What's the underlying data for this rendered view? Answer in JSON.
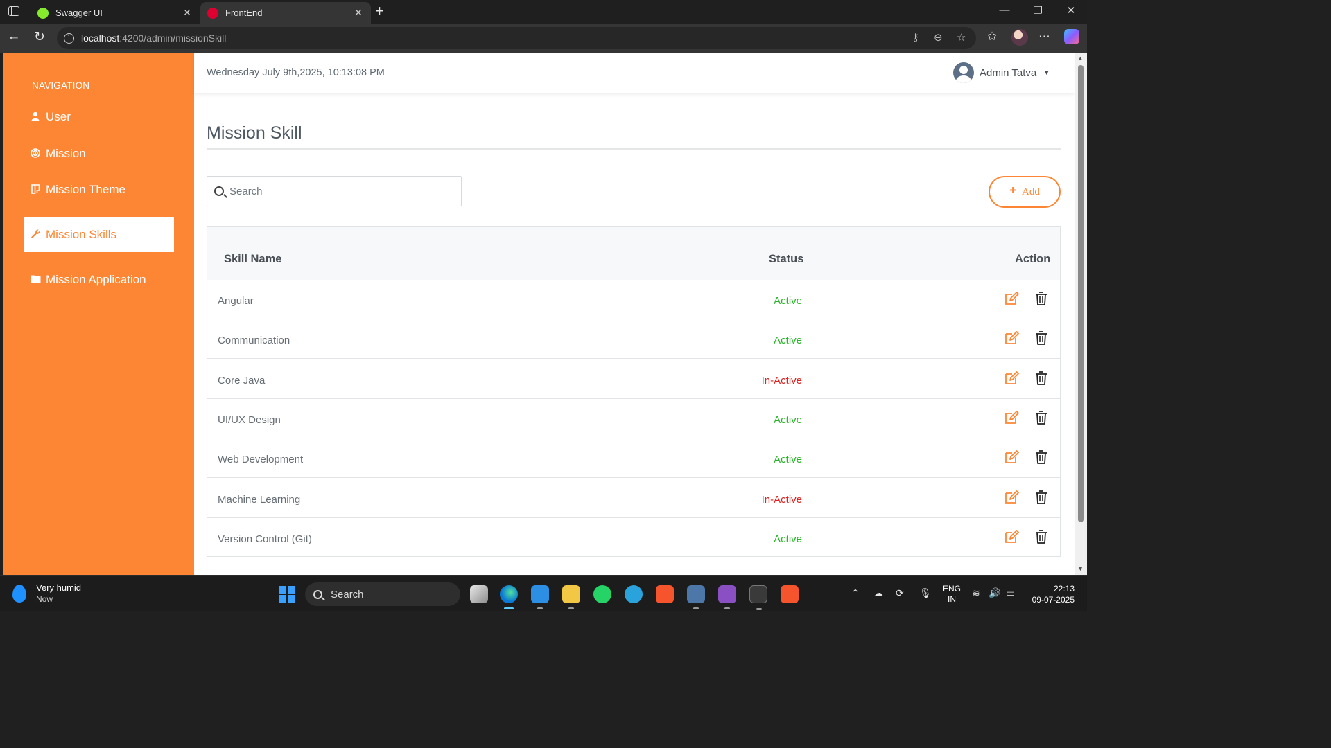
{
  "browser": {
    "tabs": [
      {
        "title": "Swagger UI",
        "favicon_color": "#85ea2d"
      },
      {
        "title": "FrontEnd",
        "favicon_color": "#dd0031"
      }
    ],
    "url_host": "localhost",
    "url_path": ":4200/admin/missionSkill"
  },
  "sidebar": {
    "heading": "NAVIGATION",
    "items": [
      {
        "label": "User",
        "icon": "user-icon"
      },
      {
        "label": "Mission",
        "icon": "target-icon"
      },
      {
        "label": "Mission Theme",
        "icon": "theme-icon"
      },
      {
        "label": "Mission Skills",
        "icon": "wrench-icon",
        "active": true
      },
      {
        "label": "Mission Application",
        "icon": "folder-icon"
      }
    ]
  },
  "header": {
    "datetime": "Wednesday July 9th,2025, 10:13:08 PM",
    "user_name": "Admin Tatva"
  },
  "page": {
    "title": "Mission Skill",
    "search_placeholder": "Search",
    "add_label": "Add"
  },
  "table": {
    "columns": {
      "name": "Skill Name",
      "status": "Status",
      "action": "Action"
    },
    "rows": [
      {
        "name": "Angular",
        "status": "Active"
      },
      {
        "name": "Communication",
        "status": "Active"
      },
      {
        "name": "Core Java",
        "status": "In-Active"
      },
      {
        "name": "UI/UX Design",
        "status": "Active"
      },
      {
        "name": "Web Development",
        "status": "Active"
      },
      {
        "name": "Machine Learning",
        "status": "In-Active"
      },
      {
        "name": "Version Control (Git)",
        "status": "Active"
      }
    ]
  },
  "colors": {
    "accent": "#fd8634",
    "active": "#26b426",
    "inactive": "#e0201f"
  },
  "taskbar": {
    "weather_title": "Very humid",
    "weather_sub": "Now",
    "search_label": "Search",
    "lang_top": "ENG",
    "lang_bottom": "IN",
    "time": "22:13",
    "date": "09-07-2025"
  }
}
